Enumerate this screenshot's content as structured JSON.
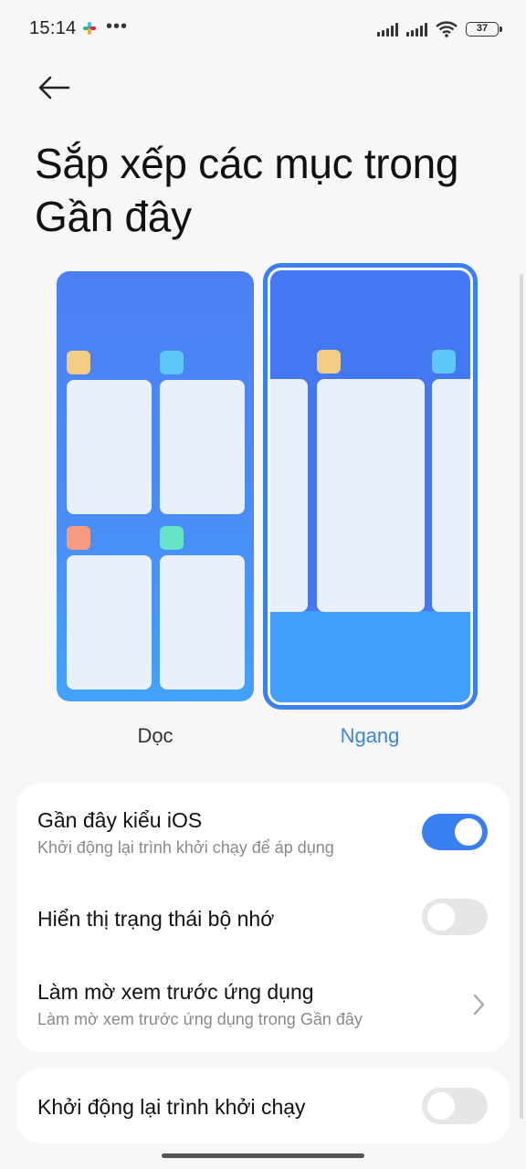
{
  "status_bar": {
    "time": "15:14",
    "more": "•••",
    "battery": "37",
    "icons": [
      "app-notification-icon",
      "signal-icon",
      "signal-icon",
      "wifi-icon",
      "battery-icon"
    ]
  },
  "header": {
    "back_icon": "arrow-left-icon",
    "title": "Sắp xếp các mục trong Gần đây"
  },
  "layout_options": {
    "vertical_label": "Dọc",
    "horizontal_label": "Ngang",
    "selected": "Ngang"
  },
  "settings": {
    "ios_recents": {
      "title": "Gần đây kiểu iOS",
      "subtitle": "Khởi động lại trình khởi chạy để áp dụng",
      "enabled": true
    },
    "memory_status": {
      "title": "Hiển thị trạng thái bộ nhớ",
      "enabled": false
    },
    "blur_preview": {
      "title": "Làm mờ xem trước ứng dụng",
      "subtitle": "Làm mờ xem trước ứng dụng trong Gần đây"
    },
    "restart_launcher": {
      "title": "Khởi động lại trình khởi chạy",
      "enabled": false
    }
  },
  "colors": {
    "accent": "#3a7ff2",
    "selected_label": "#3a86e0",
    "toggle_off": "#e6e6e6",
    "background": "#f7f7f7"
  }
}
